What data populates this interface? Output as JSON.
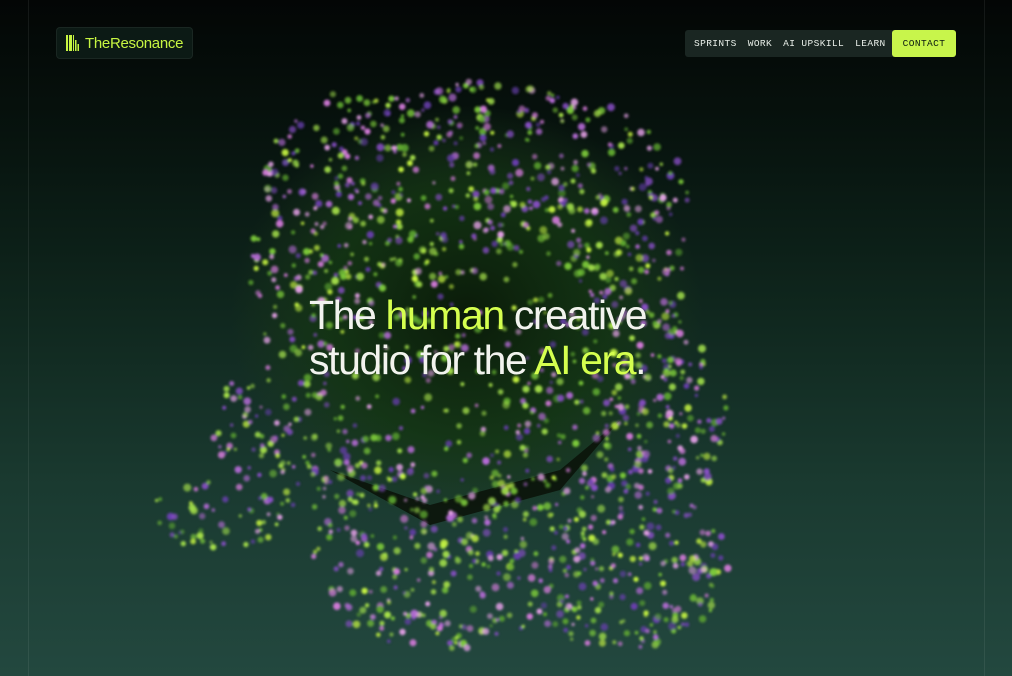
{
  "brand": {
    "name": "TheResonance",
    "accent_color": "#c8f54b"
  },
  "nav": {
    "links": [
      "SPRINTS",
      "WORK",
      "AI UPSKILL",
      "LEARN"
    ],
    "contact_label": "CONTACT"
  },
  "hero": {
    "headline": {
      "line1_part1": "The ",
      "line1_accent": "human",
      "line1_part2": " creative",
      "line2_part1": "studio for the ",
      "line2_accent": "AI era",
      "line2_end": "."
    }
  },
  "icons": {
    "logo": "barcode-mark-icon"
  }
}
